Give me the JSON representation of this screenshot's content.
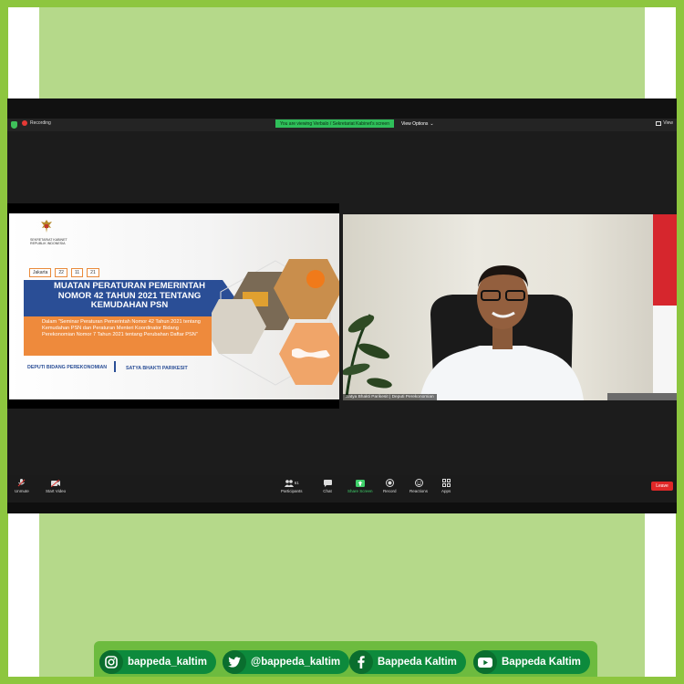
{
  "zoom": {
    "recording_label": "Recording",
    "viewing_banner": "You are viewing Verbalo / Sekretariat Kabinet's screen",
    "view_options_label": "View Options",
    "view_label": "View",
    "toolbar": {
      "unmute": "Unmute",
      "start_video": "Start Video",
      "participants": "Participants",
      "participants_count": "61",
      "chat": "Chat",
      "share_screen": "Share Screen",
      "record": "Record",
      "reactions": "Reactions",
      "apps": "Apps",
      "leave": "Leave"
    },
    "colors": {
      "accent_green": "#2fbf5a",
      "leave_red": "#e02828"
    }
  },
  "slide": {
    "org_line1": "SEKRETARIAT KABINET",
    "org_line2": "REPUBLIK INDONESIA",
    "date_city": "Jakarta",
    "date_day": "22",
    "date_month": "11",
    "date_year": "21",
    "title": "MUATAN PERATURAN PEMERINTAH NOMOR 42 TAHUN 2021 TENTANG KEMUDAHAN PSN",
    "subtitle": "Dalam \"Seminar Peraturan Pemerintah Nomor 42 Tahun 2021 tentang Kemudahan PSN dan Peraturan Menteri Koordinator Bidang Perekonomian Nomor 7 Tahun 2021 tentang Perubahan Daftar PSN\"",
    "deputi": "DEPUTI BIDANG PEREKONOMIAN",
    "speaker": "SATYA BHAKTI PARIKESIT",
    "colors": {
      "blue": "#2a4e96",
      "orange": "#ee8a3c"
    }
  },
  "video": {
    "participant_label": "Satya Bhakti Parikesit | Deputi Perekonomian"
  },
  "social": [
    {
      "icon": "instagram-icon",
      "label": "bappeda_kaltim"
    },
    {
      "icon": "twitter-icon",
      "label": "@bappeda_kaltim"
    },
    {
      "icon": "facebook-icon",
      "label": "Bappeda Kaltim"
    },
    {
      "icon": "youtube-icon",
      "label": "Bappeda Kaltim"
    }
  ],
  "frame_colors": {
    "outer_green": "#8dc63f",
    "inner_green": "#b5d98a",
    "social_green": "#0d8a3c"
  }
}
